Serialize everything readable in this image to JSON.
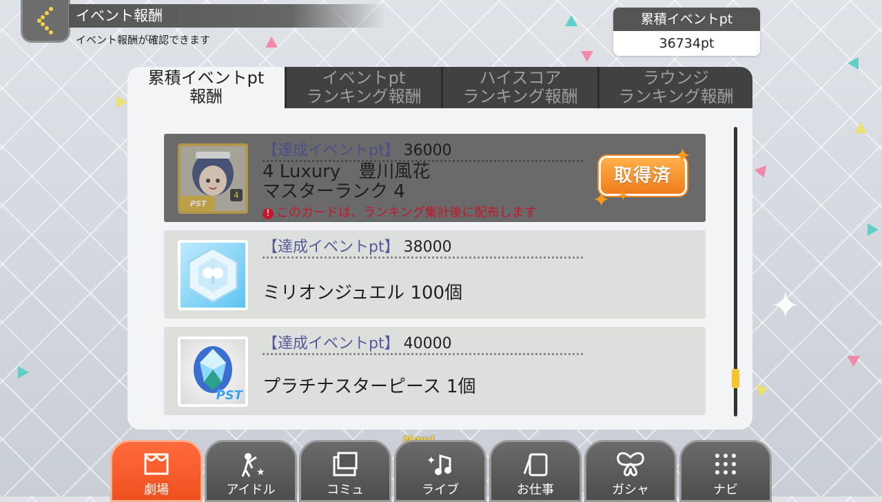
{
  "header": {
    "title": "イベント報酬",
    "subtitle": "イベント報酬が確認できます"
  },
  "points": {
    "label": "累積イベントpt",
    "value": "36734pt"
  },
  "tabs": [
    {
      "label": "累積イベントpt\n報酬",
      "active": true
    },
    {
      "label": "イベントpt\nランキング報酬",
      "active": false
    },
    {
      "label": "ハイスコア\nランキング報酬",
      "active": false
    },
    {
      "label": "ラウンジ\nランキング報酬",
      "active": false
    }
  ],
  "rewards": [
    {
      "requirement_label": "【達成イベントpt】",
      "requirement_value": "36000",
      "name_line1": "4 Luxury　豊川風花",
      "name_line2": "マスターランク 4",
      "note": "このカードは、ランキング集計後に配布します",
      "status": "取得済",
      "thumb_label": "PST",
      "thumb_rank": "4"
    },
    {
      "requirement_label": "【達成イベントpt】",
      "requirement_value": "38000",
      "name": "ミリオンジュエル 100個"
    },
    {
      "requirement_label": "【達成イベントpt】",
      "requirement_value": "40000",
      "name": "プラチナスターピース 1個",
      "thumb_label": "PST"
    }
  ],
  "nav": {
    "new_tag": "New!",
    "items": [
      {
        "label": "劇場",
        "icon": "theater-icon",
        "active": true
      },
      {
        "label": "アイドル",
        "icon": "idol-icon",
        "active": false
      },
      {
        "label": "コミュ",
        "icon": "commu-icon",
        "active": false
      },
      {
        "label": "ライブ",
        "icon": "music-note-icon",
        "active": false
      },
      {
        "label": "お仕事",
        "icon": "work-icon",
        "active": false
      },
      {
        "label": "ガシャ",
        "icon": "butterfly-icon",
        "active": false
      },
      {
        "label": "ナビ",
        "icon": "grid-dots-icon",
        "active": false
      }
    ]
  },
  "colors": {
    "accent_orange": "#f0501f",
    "requirement_blue": "#555a9a",
    "note_red": "#c2182d",
    "scroll_yellow": "#f3c531"
  }
}
